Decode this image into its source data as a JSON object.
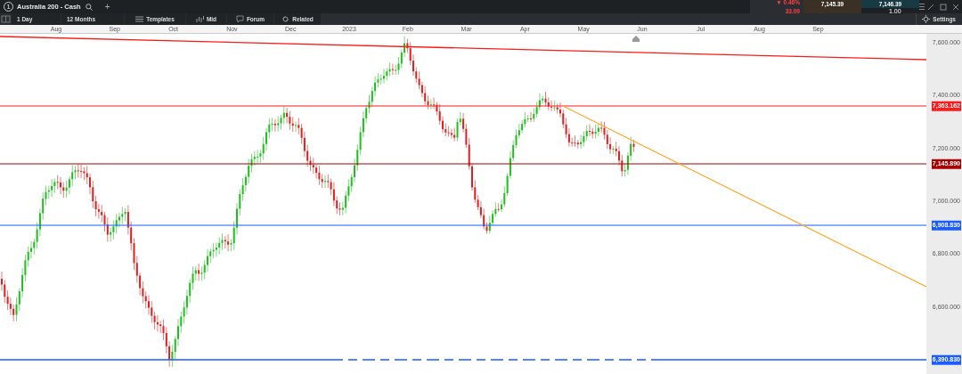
{
  "tab": {
    "number": "1",
    "title": "Australia 200 - Cash",
    "add": "+"
  },
  "quote": {
    "change_pct": "▼ 0.46%",
    "change": "33.09",
    "sell": "7,145.39",
    "buy": "7,146.39",
    "spread": "1.00"
  },
  "toolbar": {
    "buttons": [
      {
        "label": "1 Day",
        "kind": "text"
      },
      {
        "label": "12 Months",
        "kind": "text"
      },
      {
        "label": "Templates",
        "kind": "templates"
      },
      {
        "label": "Mid",
        "kind": "mid"
      },
      {
        "label": "Forum",
        "kind": "forum"
      },
      {
        "label": "Related",
        "kind": "related"
      }
    ],
    "settings": "Settings"
  },
  "x_axis": [
    "Aug",
    "Sep",
    "Oct",
    "Nov",
    "Dec",
    "2023",
    "Feb",
    "Mar",
    "Apr",
    "May",
    "Jun",
    "Jul",
    "Aug",
    "Sep"
  ],
  "y_axis": [
    "7,600.000",
    "7,400.000",
    "7,200.000",
    "7,000.000",
    "6,800.000",
    "6,600.000"
  ],
  "price_lines": [
    {
      "label": "7,363.162",
      "color": "#ff1a1a",
      "kind": "solid"
    },
    {
      "label": "7,145.890",
      "color": "#a80000",
      "kind": "solid"
    },
    {
      "label": "6,908.830",
      "color": "#1a5cff",
      "kind": "solid"
    },
    {
      "label": "6,390.830",
      "color": "#1a5cff",
      "kind": "dashed"
    }
  ]
}
